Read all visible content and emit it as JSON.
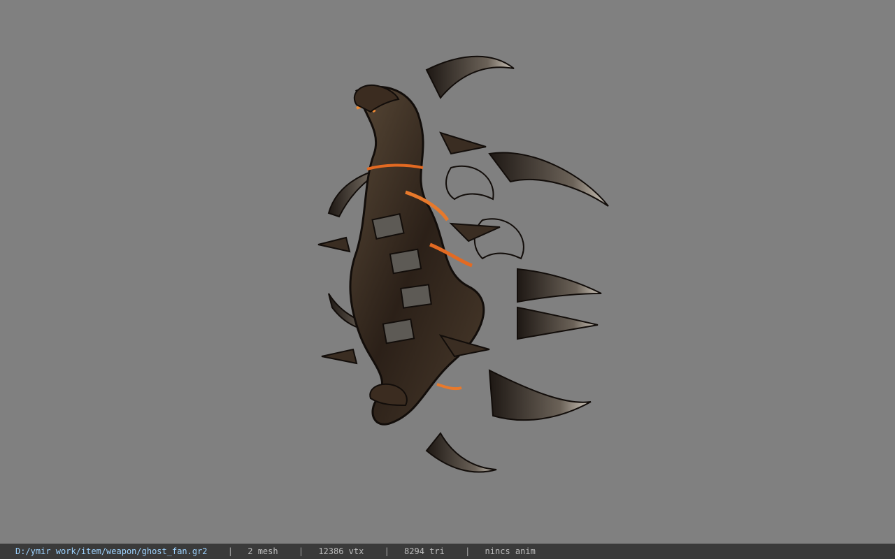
{
  "viewport": {
    "background": "#808080",
    "model_icon": "weapon-model-icon"
  },
  "status": {
    "file_path": "D:/ymir work/item/weapon/ghost_fan.gr2",
    "separator": "|",
    "mesh": "2 mesh",
    "vertices": "12386 vtx",
    "triangles": "8294 tri",
    "anim": "nincs anim"
  }
}
